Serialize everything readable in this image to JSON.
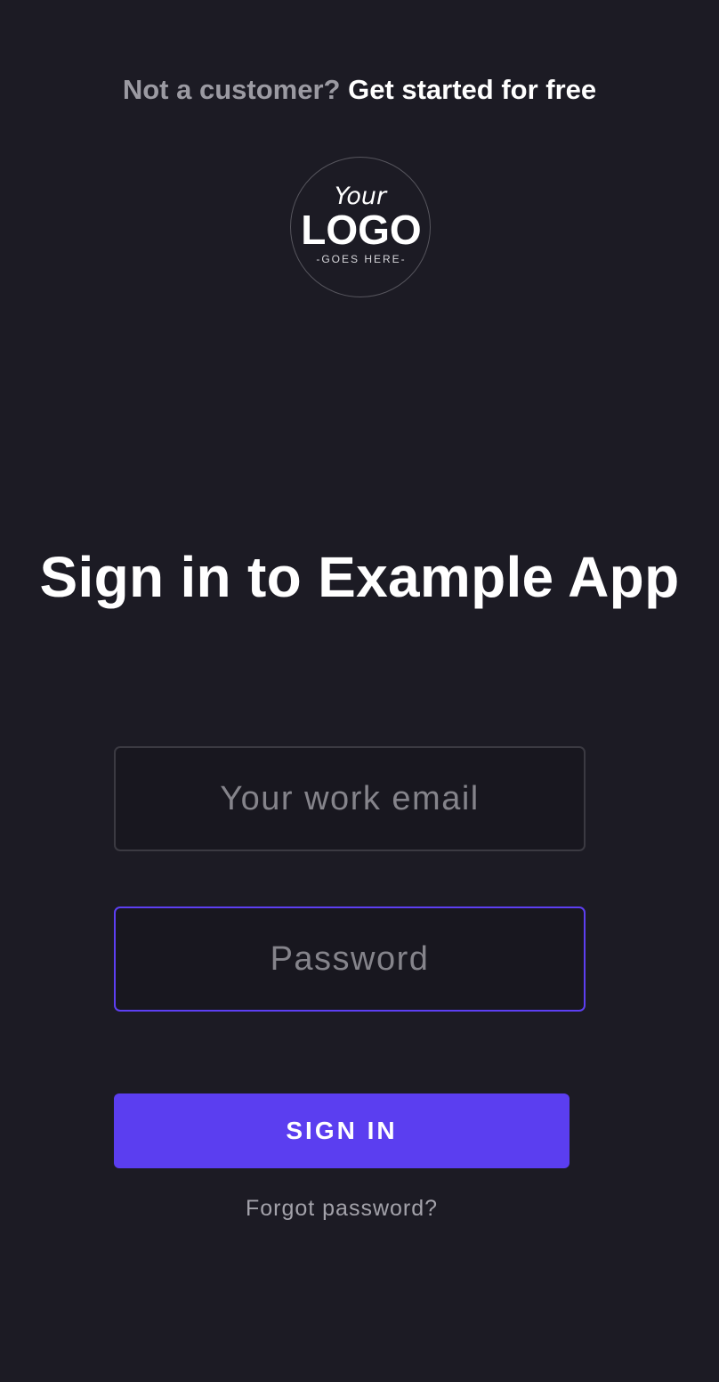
{
  "header": {
    "prompt_text": "Not a customer?",
    "signup_link": "Get started for free"
  },
  "logo": {
    "line1": "Your",
    "line2": "LOGO",
    "line3": "-GOES HERE-"
  },
  "title": "Sign in to Example App",
  "form": {
    "email_placeholder": "Your work email",
    "email_value": "",
    "password_placeholder": "Password",
    "password_value": "",
    "submit_label": "SIGN IN",
    "forgot_link": "Forgot password?"
  },
  "colors": {
    "background": "#1c1b24",
    "accent": "#5b3ef0",
    "muted_text": "#9b9aa2"
  }
}
